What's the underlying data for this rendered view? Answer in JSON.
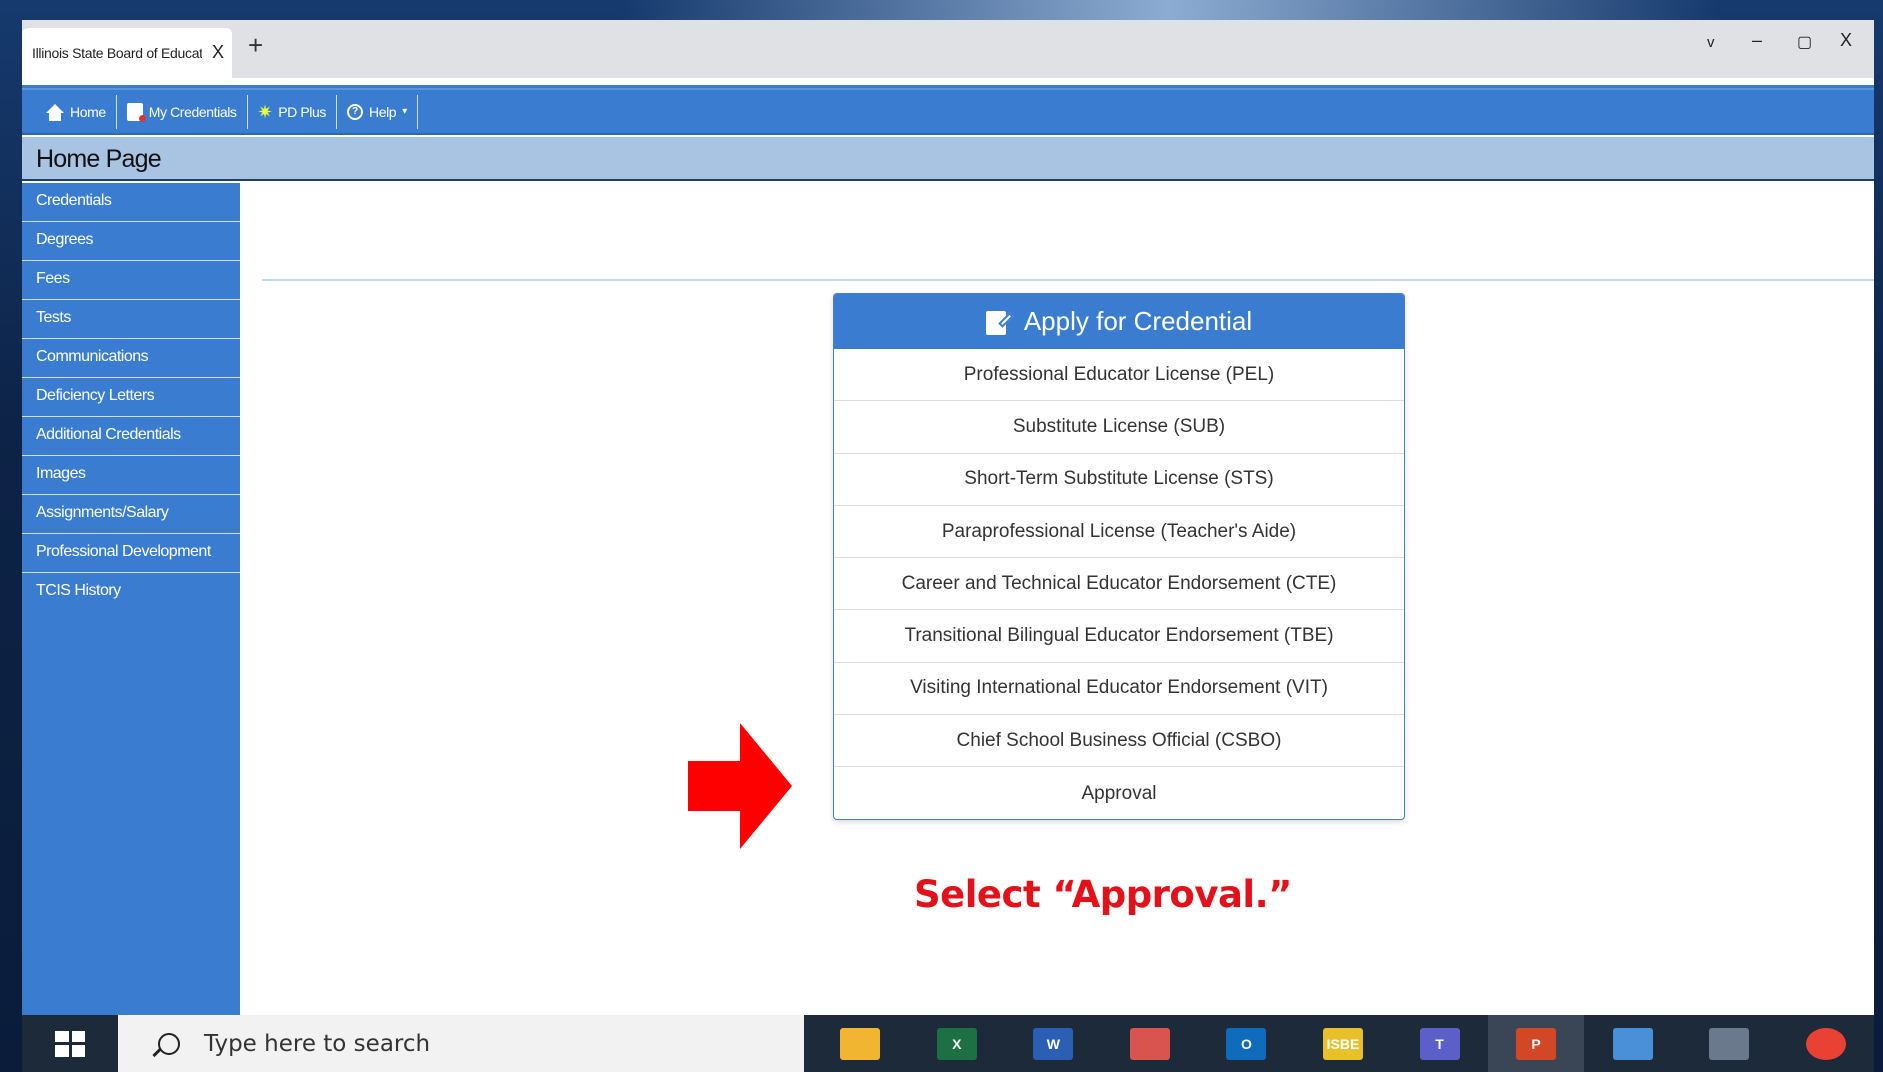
{
  "browser": {
    "tab_title": "Illinois State Board of Education",
    "tab_close": "X",
    "new_tab": "+",
    "controls": {
      "dropdown": "v",
      "minimize": "–",
      "restore": "▢",
      "close": "X"
    }
  },
  "navbar": {
    "items": [
      {
        "label": "Home",
        "icon": "home-icon"
      },
      {
        "label": "My Credentials",
        "icon": "credentials-icon"
      },
      {
        "label": "PD Plus",
        "icon": "star-icon"
      },
      {
        "label": "Help",
        "icon": "help-icon"
      }
    ]
  },
  "page_title": "Home Page",
  "sidebar": {
    "items": [
      {
        "label": "Credentials"
      },
      {
        "label": "Degrees"
      },
      {
        "label": "Fees"
      },
      {
        "label": "Tests"
      },
      {
        "label": "Communications"
      },
      {
        "label": "Deficiency Letters"
      },
      {
        "label": "Additional Credentials"
      },
      {
        "label": "Images"
      },
      {
        "label": "Assignments/Salary"
      },
      {
        "label": "Professional Development"
      },
      {
        "label": "TCIS History"
      }
    ]
  },
  "apply_card": {
    "title": "Apply for Credential",
    "options": [
      {
        "label": "Professional Educator License (PEL)"
      },
      {
        "label": "Substitute License (SUB)"
      },
      {
        "label": "Short-Term Substitute License (STS)"
      },
      {
        "label": "Paraprofessional License (Teacher's Aide)"
      },
      {
        "label": "Career and Technical Educator Endorsement (CTE)"
      },
      {
        "label": "Transitional Bilingual Educator Endorsement (TBE)"
      },
      {
        "label": "Visiting International Educator Endorsement (VIT)"
      },
      {
        "label": "Chief School Business Official (CSBO)"
      },
      {
        "label": "Approval"
      }
    ]
  },
  "annotation": {
    "callout": "Select “Approval.”",
    "arrow_color": "#ff0000"
  },
  "taskbar": {
    "search_placeholder": "Type here to search",
    "apps": [
      {
        "name": "file-explorer-icon",
        "label": "",
        "color": "#f2b531"
      },
      {
        "name": "excel-icon",
        "label": "X",
        "color": "#1d7044"
      },
      {
        "name": "word-icon",
        "label": "W",
        "color": "#2b5fb4"
      },
      {
        "name": "snipping-tool-icon",
        "label": "",
        "color": "#d9534f"
      },
      {
        "name": "outlook-icon",
        "label": "O",
        "color": "#0f6cbd"
      },
      {
        "name": "isbe-icon",
        "label": "ISBE",
        "color": "#e8c02a"
      },
      {
        "name": "teams-icon",
        "label": "T",
        "color": "#5b5fc7"
      },
      {
        "name": "powerpoint-icon",
        "label": "P",
        "color": "#d24726"
      },
      {
        "name": "laptop-icon",
        "label": "",
        "color": "#4a90d9"
      },
      {
        "name": "calculator-icon",
        "label": "",
        "color": "#6a7a8c"
      },
      {
        "name": "chrome-icon",
        "label": "",
        "color": "#e94235"
      }
    ]
  }
}
